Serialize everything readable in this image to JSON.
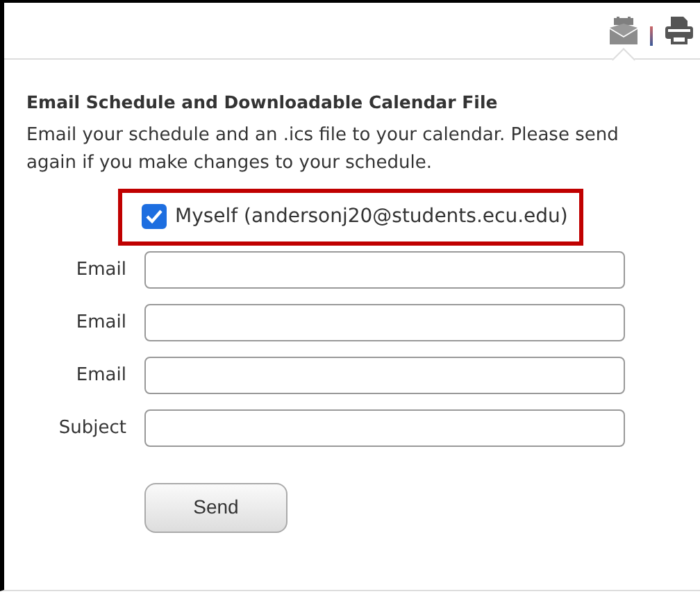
{
  "toolbar": {
    "icons": [
      {
        "kind": "email-calendar",
        "selected": true
      },
      {
        "kind": "print",
        "selected": false
      }
    ]
  },
  "heading": "Email Schedule and Downloadable Calendar File",
  "description": "Email your schedule and an .ics file to your calendar. Please send again if you make changes to your schedule.",
  "myself": {
    "label": "Myself (andersonj20@students.ecu.edu)",
    "checked": true,
    "highlighted": true
  },
  "fields": [
    {
      "label": "Email"
    },
    {
      "label": "Email"
    },
    {
      "label": "Email"
    },
    {
      "label": "Subject"
    }
  ],
  "button": "Send"
}
